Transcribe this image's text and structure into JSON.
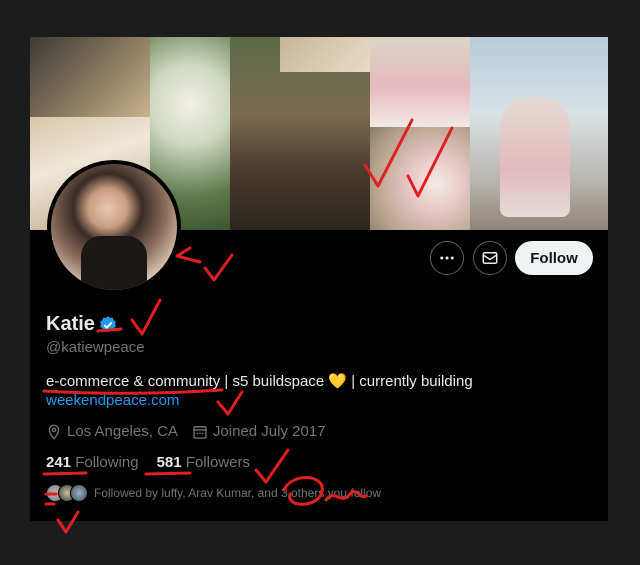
{
  "profile": {
    "name": "Katie",
    "handle": "@katiewpeace",
    "bio_main": "e-commerce & community | s5 buildspace ",
    "bio_heart": "💛",
    "bio_tail": " | currently building",
    "website": "weekendpeace.com",
    "location": "Los Angeles, CA",
    "joined": "Joined July 2017",
    "following_count": "241",
    "following_label": "Following",
    "followers_count": "581",
    "followers_label": "Followers",
    "followed_by": "Followed by luffy, Arav Kumar, and 3 others you follow"
  },
  "actions": {
    "follow_label": "Follow",
    "more_icon": "more-icon",
    "message_icon": "mail-icon"
  },
  "colors": {
    "background": "#000000",
    "accent_link": "#1d9bf0",
    "verified": "#1d9bf0",
    "annotation_red": "#e02020",
    "follow_button_bg": "#eff3f4"
  }
}
